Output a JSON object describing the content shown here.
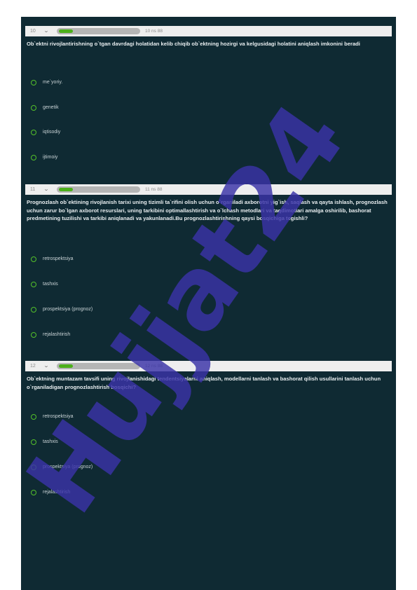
{
  "questions": [
    {
      "number": "10",
      "counter": "10 ns 88",
      "progress": 0.17,
      "text": "Ob`ektni rivojlantirishning o`tgan davrdagi holatidan kelib chiqib ob`ektning hozirgi va kelgusidagi holatini aniqlash imkonini beradi",
      "options": [
        "me`yoriy.",
        "genetik",
        "iqtisodiy",
        "ijtimoiy"
      ]
    },
    {
      "number": "11",
      "counter": "11 ns 88",
      "progress": 0.17,
      "text": "Prognozlash ob`ektining rivojlanish tarixi uning tizimli ta`rifini olish uchun o`rganiladi axborotni yig`ish, saqlash va qayta ishlash, prognozlash uchun zarur bo`lgan axborot resurslari, uning tarkibini optimallashtirish va o`lchash metodlari va taqdimotlari amalga oshirilib, bashorat predmetining tuzilishi va tarkibi aniqlanadi va yakunlanadi.Bu prognozlashtirishning qaysi bosqichiga tegishli?",
      "options": [
        "retrospektsiya",
        "tashxis",
        "prospektsiya (prognoz)",
        "rejalashtirish"
      ]
    },
    {
      "number": "12",
      "counter": "12 ns 88",
      "progress": 0.17,
      "text": "Ob`ektning muntazam tavsifi uning rivojlanishidagi tendentsiyalarni aniqlash, modellarni tanlash va bashorat qilish usullarini tanlash uchun o`rganiladigan prognozlashtirish bosqichi?",
      "options": [
        "retrospektsiya",
        "tashxis",
        "prospektsiya (prognoz)",
        "rejalashtirish"
      ]
    }
  ],
  "watermark": {
    "text": "Hujjat24",
    "color": "#3a33a8"
  },
  "colors": {
    "panel": "#0f2a33",
    "accent": "#4caf1a",
    "bar": "#eeeeee"
  }
}
